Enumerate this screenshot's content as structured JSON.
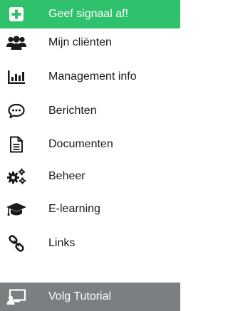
{
  "menu": {
    "items": [
      {
        "label": "Geef signaal af!",
        "icon": "plus-square-icon"
      },
      {
        "label": "Mijn cliënten",
        "icon": "users-icon"
      },
      {
        "label": "Management info",
        "icon": "bar-chart-icon"
      },
      {
        "label": "Berichten",
        "icon": "comment-dots-icon"
      },
      {
        "label": "Documenten",
        "icon": "file-text-icon"
      },
      {
        "label": "Beheer",
        "icon": "cogs-icon"
      },
      {
        "label": "E-learning",
        "icon": "graduation-cap-icon"
      },
      {
        "label": "Links",
        "icon": "link-icon"
      },
      {
        "label": "Volg Tutorial",
        "icon": "tutorial-screen-icon"
      }
    ]
  },
  "colors": {
    "signal_bg": "#2fc16b",
    "tutorial_bg": "#7c7f82",
    "icon_dark": "#1a1a1a"
  }
}
